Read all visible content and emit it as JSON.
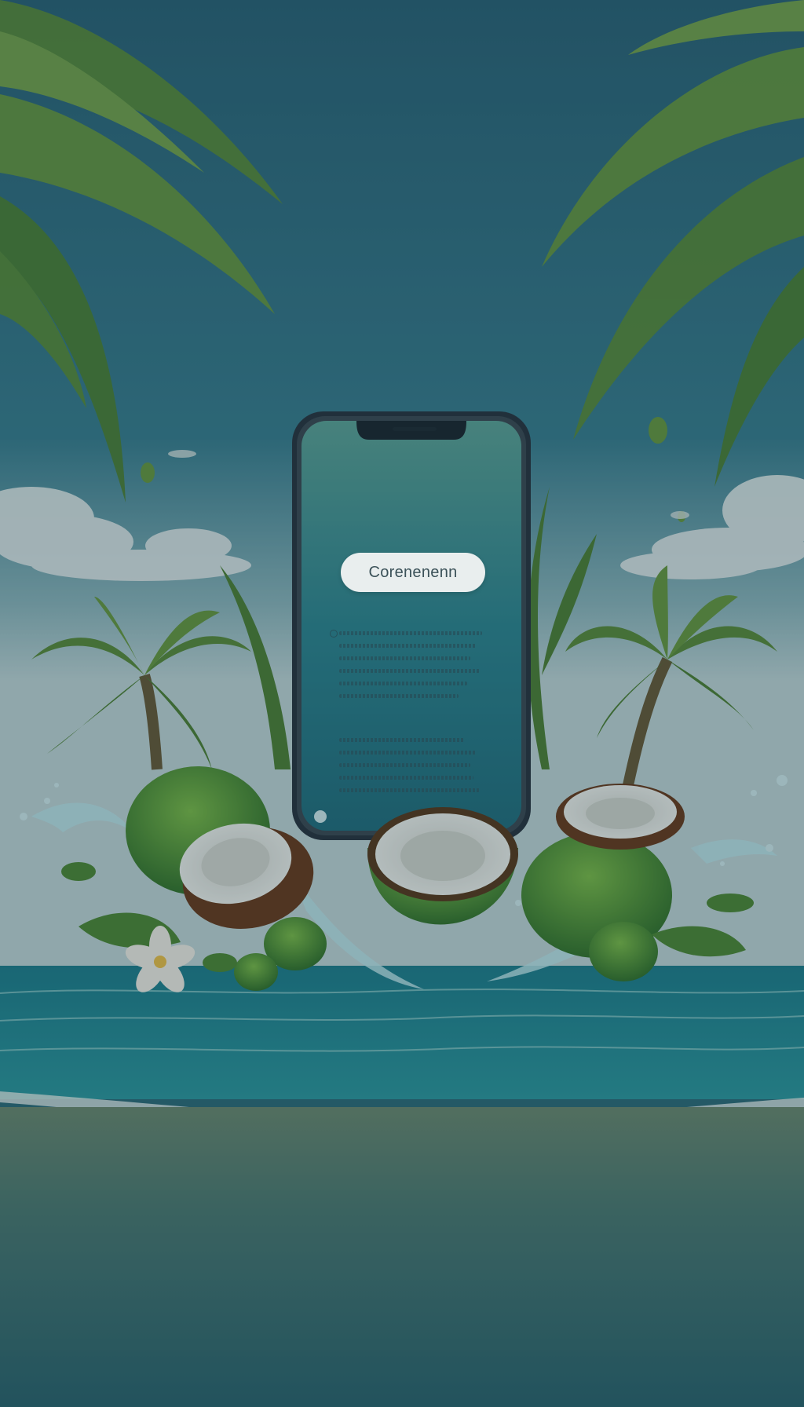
{
  "app": {
    "pill_label": "Corenenenn"
  },
  "icons": {
    "palm": "palm-tree-icon",
    "coconut": "coconut-icon",
    "splash": "water-splash-icon",
    "flower": "plumeria-flower-icon"
  },
  "colors": {
    "sky_top": "#2e6a7e",
    "sky_bottom": "#cfe2e6",
    "sea": "#1e8a96",
    "sand": "#6f8a73",
    "leaf": "#5f9a3a",
    "screen": "#2f8794",
    "pill_bg": "#e9eeee"
  }
}
